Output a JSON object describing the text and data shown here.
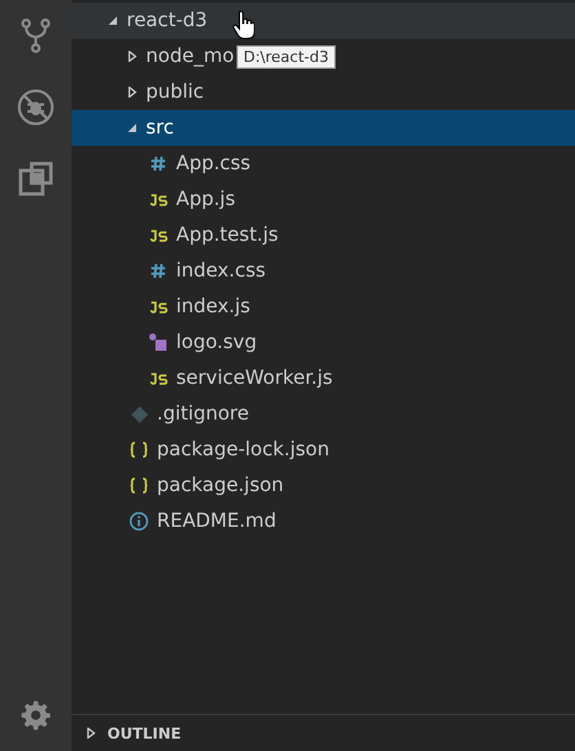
{
  "activity_bar": {
    "items": [
      {
        "kind": "source-control",
        "selected": false
      },
      {
        "kind": "debug",
        "selected": false
      },
      {
        "kind": "extensions",
        "selected": false
      }
    ],
    "bottom": [
      {
        "kind": "settings"
      }
    ]
  },
  "tree": [
    {
      "name": "react-d3",
      "kind": "folder",
      "expanded": true,
      "selected": false,
      "hovered": true,
      "tooltip": "D:\\react-d3",
      "children": [
        {
          "name": "node_mo",
          "kind": "folder",
          "expanded": false,
          "selected": false,
          "hovered": false
        },
        {
          "name": "public",
          "kind": "folder",
          "expanded": false,
          "selected": false,
          "hovered": false
        },
        {
          "name": "src",
          "kind": "folder",
          "expanded": true,
          "selected": true,
          "hovered": false,
          "children": [
            {
              "name": "App.css",
              "kind": "css",
              "selected": false,
              "hovered": false
            },
            {
              "name": "App.js",
              "kind": "js",
              "selected": false,
              "hovered": false
            },
            {
              "name": "App.test.js",
              "kind": "js",
              "selected": false,
              "hovered": false
            },
            {
              "name": "index.css",
              "kind": "css",
              "selected": false,
              "hovered": false
            },
            {
              "name": "index.js",
              "kind": "js",
              "selected": false,
              "hovered": false
            },
            {
              "name": "logo.svg",
              "kind": "svg",
              "selected": false,
              "hovered": false
            },
            {
              "name": "serviceWorker.js",
              "kind": "js",
              "selected": false,
              "hovered": false
            }
          ]
        },
        {
          "name": ".gitignore",
          "kind": "git",
          "selected": false,
          "hovered": false
        },
        {
          "name": "package-lock.json",
          "kind": "json",
          "selected": false,
          "hovered": false
        },
        {
          "name": "package.json",
          "kind": "json",
          "selected": false,
          "hovered": false
        },
        {
          "name": "README.md",
          "kind": "info",
          "selected": false,
          "hovered": false
        }
      ]
    }
  ],
  "outline": {
    "title": "OUTLINE",
    "expanded": false
  }
}
